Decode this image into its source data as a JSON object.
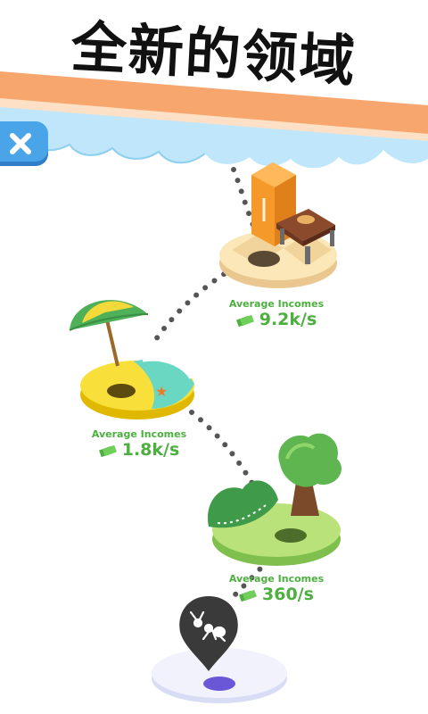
{
  "header": {
    "title": "全新的领域"
  },
  "controls": {
    "close_icon": "close-icon"
  },
  "islands": [
    {
      "name": "kitchen",
      "income_label": "Average Incomes",
      "income_value": "9.2k/s"
    },
    {
      "name": "beach",
      "income_label": "Average Incomes",
      "income_value": "1.8k/s"
    },
    {
      "name": "garden",
      "income_label": "Average Incomes",
      "income_value": "360/s"
    }
  ],
  "marker": {
    "icon": "ant-map-pin-icon"
  },
  "colors": {
    "close_button": "#4aa4e8",
    "income_text": "#4caf3f",
    "sky_cloud": "#bfe6fa",
    "orange_stripe": "#f7a66e"
  }
}
